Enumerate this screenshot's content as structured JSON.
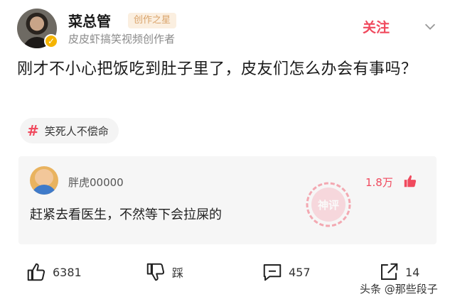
{
  "author": {
    "name": "菜总管",
    "badge": "创作之星",
    "subtitle": "皮皮虾搞笑视频创作者",
    "follow_label": "关注"
  },
  "post": {
    "text": "刚才不小心把饭吃到肚子里了，皮友们怎么办会有事吗？",
    "topic": "笑死人不偿命"
  },
  "top_comment": {
    "username": "胖虎00000",
    "likes": "1.8万",
    "text": "赶紧去看医生，不然等下会拉屎的",
    "stamp_text": "神评"
  },
  "actions": {
    "like_count": "6381",
    "dislike_label": "踩",
    "comment_count": "457",
    "share_count": "14"
  },
  "watermark": "头条 @那些段子",
  "colors": {
    "accent": "#f04a5e",
    "badge_text": "#d9a36a",
    "verified": "#f5b400"
  }
}
